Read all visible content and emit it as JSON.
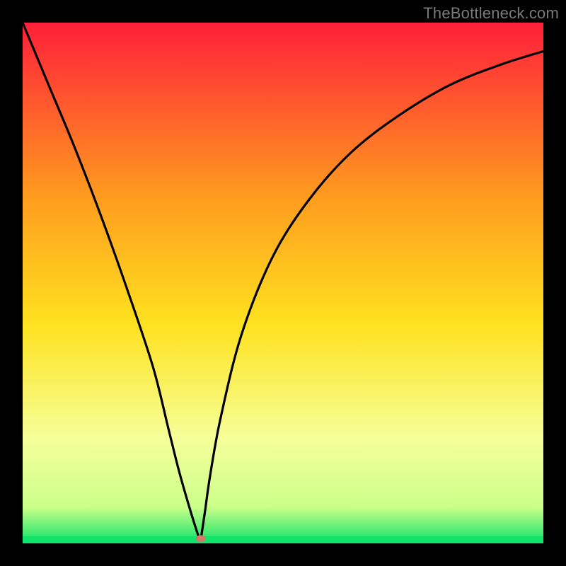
{
  "watermark": "TheBottleneck.com",
  "chart_data": {
    "type": "line",
    "title": "",
    "xlabel": "",
    "ylabel": "",
    "xlim": [
      0,
      100
    ],
    "ylim": [
      0,
      100
    ],
    "grid": false,
    "legend": false,
    "colors": {
      "line": "#000000",
      "frame": "#000000",
      "gradient_top": "#ff1f3a",
      "gradient_mid_upper": "#ff9a1f",
      "gradient_mid": "#ffe21f",
      "gradient_lower": "#f6ff9a",
      "gradient_near_bottom": "#caff8a",
      "gradient_bottom": "#10e36a",
      "bottom_bar": "#10e36a"
    },
    "series": [
      {
        "name": "curve",
        "x": [
          0,
          5,
          10,
          15,
          20,
          25,
          28,
          30,
          32,
          33.8,
          34.2,
          34.3,
          35,
          36,
          38,
          42,
          48,
          55,
          63,
          72,
          82,
          92,
          100
        ],
        "y": [
          100,
          88,
          76,
          63,
          49,
          34,
          22,
          14,
          7,
          1.3,
          0.9,
          1.3,
          6,
          13,
          24,
          40,
          55,
          66,
          75,
          82,
          88,
          92,
          94.5
        ]
      }
    ],
    "minimum_marker": {
      "x": 34.2,
      "y": 0.9,
      "color": "#d47a6b",
      "rx": 7,
      "ry": 5
    }
  }
}
